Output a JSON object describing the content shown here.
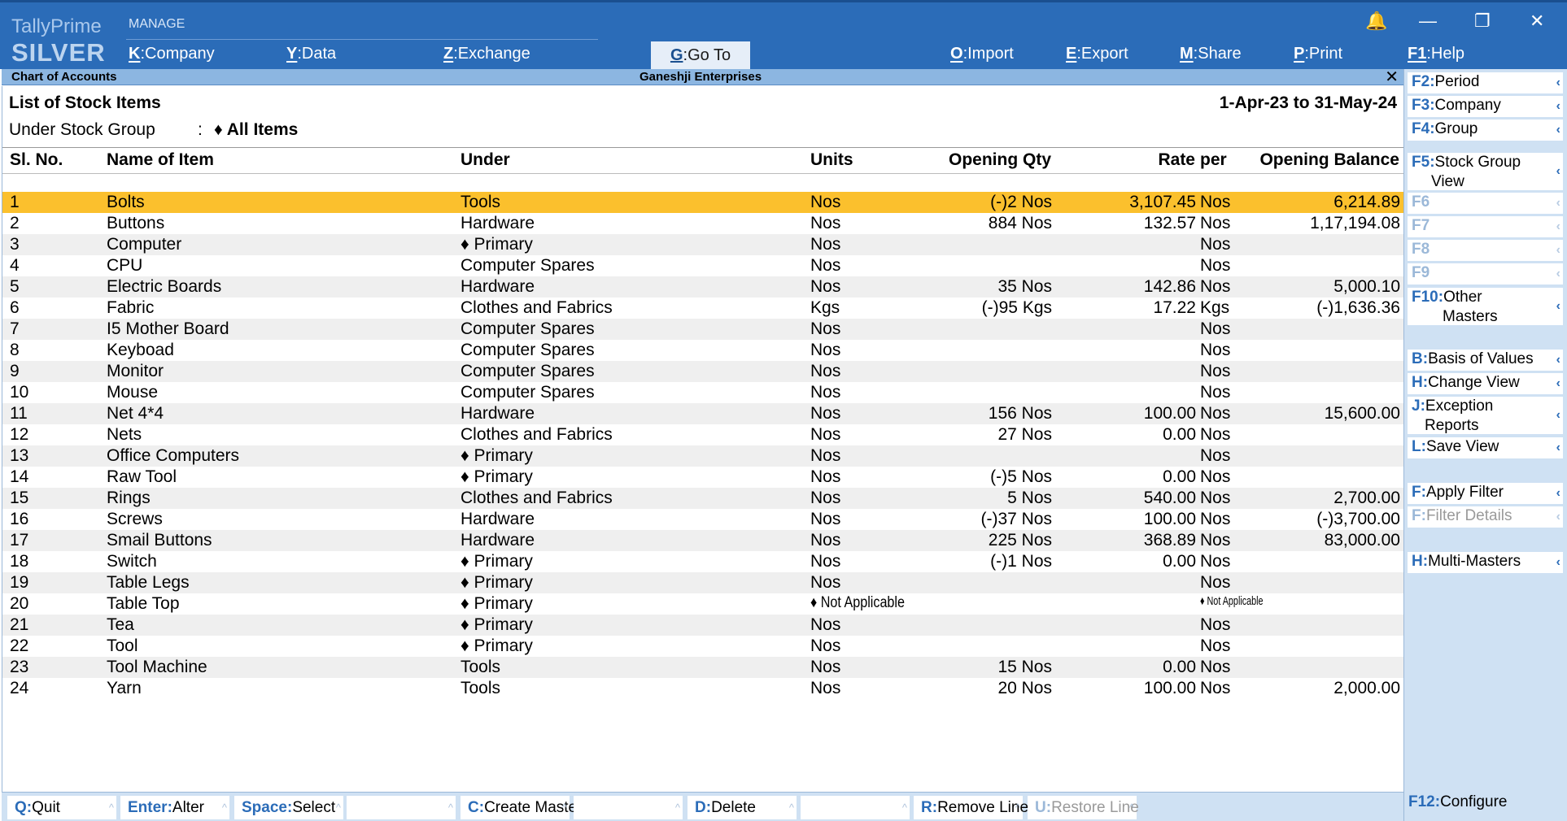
{
  "brand": {
    "line1": "TallyPrime",
    "line2": "SILVER"
  },
  "top_menu": {
    "section": "MANAGE",
    "items": [
      {
        "key": "K",
        "label": "Company"
      },
      {
        "key": "Y",
        "label": "Data"
      },
      {
        "key": "Z",
        "label": "Exchange"
      },
      {
        "key": "G",
        "label": "Go To"
      },
      {
        "key": "O",
        "label": "Import"
      },
      {
        "key": "E",
        "label": "Export"
      },
      {
        "key": "M",
        "label": "Share"
      },
      {
        "key": "P",
        "label": "Print"
      },
      {
        "key": "F1",
        "label": "Help"
      }
    ]
  },
  "title_strip": {
    "left": "Chart of Accounts",
    "center": "Ganeshji Enterprises",
    "close": "✕"
  },
  "report": {
    "title": "List of Stock Items",
    "period": "1-Apr-23 to 31-May-24",
    "group_label": "Under Stock Group",
    "group_colon": ":",
    "group_value": "♦ All Items"
  },
  "columns": [
    "Sl. No.",
    "Name of Item",
    "Under",
    "Units",
    "Opening Qty",
    "Rate",
    "per",
    "Opening Balance"
  ],
  "rows": [
    [
      "1",
      "Bolts",
      "Tools",
      "Nos",
      "(-)2 Nos",
      "3,107.45",
      "Nos",
      "6,214.89"
    ],
    [
      "2",
      "Buttons",
      "Hardware",
      "Nos",
      "884 Nos",
      "132.57",
      "Nos",
      "1,17,194.08"
    ],
    [
      "3",
      "Computer",
      "♦ Primary",
      "Nos",
      "",
      "",
      "Nos",
      ""
    ],
    [
      "4",
      "CPU",
      "Computer Spares",
      "Nos",
      "",
      "",
      "Nos",
      ""
    ],
    [
      "5",
      "Electric Boards",
      "Hardware",
      "Nos",
      "35 Nos",
      "142.86",
      "Nos",
      "5,000.10"
    ],
    [
      "6",
      "Fabric",
      "Clothes and Fabrics",
      "Kgs",
      "(-)95 Kgs",
      "17.22",
      "Kgs",
      "(-)1,636.36"
    ],
    [
      "7",
      "I5 Mother Board",
      "Computer Spares",
      "Nos",
      "",
      "",
      "Nos",
      ""
    ],
    [
      "8",
      "Keyboad",
      "Computer Spares",
      "Nos",
      "",
      "",
      "Nos",
      ""
    ],
    [
      "9",
      "Monitor",
      "Computer Spares",
      "Nos",
      "",
      "",
      "Nos",
      ""
    ],
    [
      "10",
      "Mouse",
      "Computer Spares",
      "Nos",
      "",
      "",
      "Nos",
      ""
    ],
    [
      "11",
      "Net 4*4",
      "Hardware",
      "Nos",
      "156 Nos",
      "100.00",
      "Nos",
      "15,600.00"
    ],
    [
      "12",
      "Nets",
      "Clothes and Fabrics",
      "Nos",
      "27 Nos",
      "0.00",
      "Nos",
      ""
    ],
    [
      "13",
      "Office Computers",
      "♦ Primary",
      "Nos",
      "",
      "",
      "Nos",
      ""
    ],
    [
      "14",
      "Raw Tool",
      "♦ Primary",
      "Nos",
      "(-)5 Nos",
      "0.00",
      "Nos",
      ""
    ],
    [
      "15",
      "Rings",
      "Clothes and Fabrics",
      "Nos",
      "5 Nos",
      "540.00",
      "Nos",
      "2,700.00"
    ],
    [
      "16",
      "Screws",
      "Hardware",
      "Nos",
      "(-)37 Nos",
      "100.00",
      "Nos",
      "(-)3,700.00"
    ],
    [
      "17",
      "Smail Buttons",
      "Hardware",
      "Nos",
      "225 Nos",
      "368.89",
      "Nos",
      "83,000.00"
    ],
    [
      "18",
      "Switch",
      "♦ Primary",
      "Nos",
      "(-)1 Nos",
      "0.00",
      "Nos",
      ""
    ],
    [
      "19",
      "Table Legs",
      "♦ Primary",
      "Nos",
      "",
      "",
      "Nos",
      ""
    ],
    [
      "20",
      "Table Top",
      "♦ Primary",
      "♦ Not Applicable",
      "",
      "",
      "♦ Not Applicable",
      ""
    ],
    [
      "21",
      "Tea",
      "♦ Primary",
      "Nos",
      "",
      "",
      "Nos",
      ""
    ],
    [
      "22",
      "Tool",
      "♦ Primary",
      "Nos",
      "",
      "",
      "Nos",
      ""
    ],
    [
      "23",
      "Tool Machine",
      "Tools",
      "Nos",
      "15 Nos",
      "0.00",
      "Nos",
      ""
    ],
    [
      "24",
      "Yarn",
      "Tools",
      "Nos",
      "20 Nos",
      "100.00",
      "Nos",
      "2,000.00"
    ]
  ],
  "right_panel": [
    {
      "key": "F2",
      "label": "Period",
      "dim": false
    },
    {
      "key": "F3",
      "label": "Company",
      "dim": false
    },
    {
      "key": "F4",
      "label": "Group",
      "dim": false
    },
    {
      "key": "F5",
      "label": "Stock Group",
      "label2": "View",
      "dim": false
    },
    {
      "key": "F6",
      "label": "",
      "dim": true
    },
    {
      "key": "F7",
      "label": "",
      "dim": true
    },
    {
      "key": "F8",
      "label": "",
      "dim": true
    },
    {
      "key": "F9",
      "label": "",
      "dim": true
    },
    {
      "key": "F10",
      "label": "Other",
      "label2": "Masters",
      "dim": false
    },
    {
      "key": "B",
      "label": "Basis of Values",
      "dim": false
    },
    {
      "key": "H",
      "label": "Change View",
      "dim": false
    },
    {
      "key": "J",
      "label": "Exception",
      "label2": "Reports",
      "dim": false
    },
    {
      "key": "L",
      "label": "Save View",
      "dim": false
    },
    {
      "key": "F",
      "label": "Apply Filter",
      "dim": false
    },
    {
      "key": "F",
      "label": "Filter Details",
      "dim": true
    },
    {
      "key": "H",
      "label": "Multi-Masters",
      "dim": false
    },
    {
      "key": "F12",
      "label": "Configure",
      "dim": false
    }
  ],
  "bottom_bar": [
    {
      "key": "Q",
      "label": "Quit",
      "dim": false
    },
    {
      "key": "Enter",
      "label": "Alter",
      "dim": false
    },
    {
      "key": "Space",
      "label": "Select",
      "dim": false
    },
    {
      "key": "",
      "label": "",
      "dim": false
    },
    {
      "key": "C",
      "label": "Create Master",
      "dim": false
    },
    {
      "key": "",
      "label": "",
      "dim": false
    },
    {
      "key": "D",
      "label": "Delete",
      "dim": false
    },
    {
      "key": "",
      "label": "",
      "dim": false
    },
    {
      "key": "R",
      "label": "Remove Line",
      "dim": false
    },
    {
      "key": "U",
      "label": "Restore Line",
      "dim": true
    }
  ],
  "window_controls": {
    "bell": "🔔",
    "minimize": "—",
    "restore": "❐",
    "close": "✕"
  },
  "colors": {
    "topbar": "#2b6cb8",
    "selected_row": "#fbc02d",
    "title_strip": "#8cb6e1",
    "side_panel": "#cfe1f3"
  }
}
